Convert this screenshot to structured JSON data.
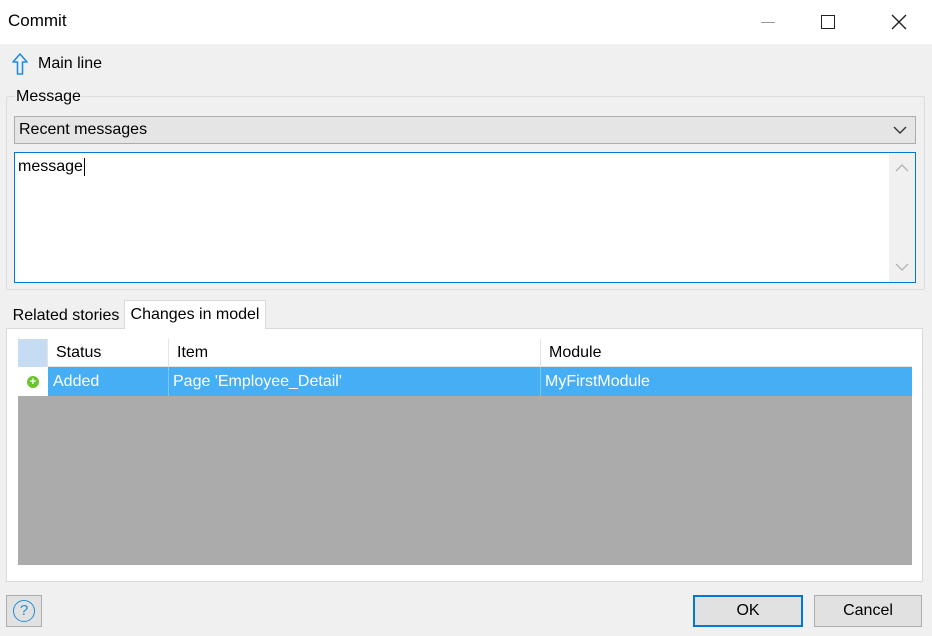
{
  "window": {
    "title": "Commit"
  },
  "branch": {
    "label": "Main line",
    "icon": "up-arrow-icon"
  },
  "message": {
    "group_label": "Message",
    "recent_select": "Recent messages",
    "text": "message"
  },
  "tabs": [
    {
      "label": "Related stories",
      "active": false
    },
    {
      "label": "Changes in model",
      "active": true
    }
  ],
  "changes_table": {
    "columns": [
      "Status",
      "Item",
      "Module"
    ],
    "rows": [
      {
        "status": "Added",
        "item": "Page 'Employee_Detail'",
        "module": "MyFirstModule",
        "selected": true
      }
    ]
  },
  "buttons": {
    "ok": "OK",
    "cancel": "Cancel"
  },
  "colors": {
    "accent": "#0078d7",
    "selection": "#45aef5",
    "added": "#6cc52e",
    "grid_empty": "#ababab"
  }
}
